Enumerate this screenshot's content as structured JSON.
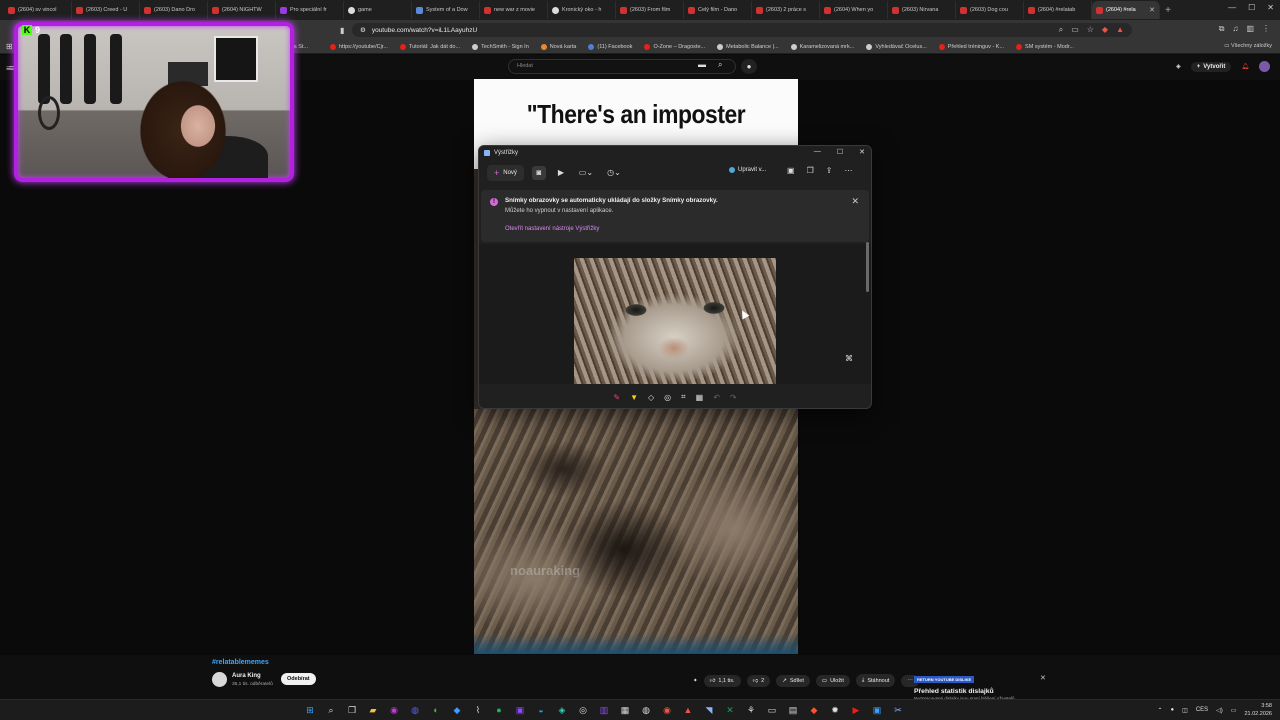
{
  "browser": {
    "tabs": [
      {
        "label": "(2604) sv vincol",
        "fav": "r"
      },
      {
        "label": "(2603) Creed - U",
        "fav": "r"
      },
      {
        "label": "(2603) Dano Dro",
        "fav": "r"
      },
      {
        "label": "(2604) NIGHTW",
        "fav": "r"
      },
      {
        "label": "Pro speciální fr",
        "fav": "p"
      },
      {
        "label": "game",
        "fav": "g"
      },
      {
        "label": "System of a Dow",
        "fav": "b"
      },
      {
        "label": "new war z movie",
        "fav": "r"
      },
      {
        "label": "Kronický oko - h",
        "fav": "g"
      },
      {
        "label": "(2603) From film",
        "fav": "r"
      },
      {
        "label": "Celý film - Dano",
        "fav": "r"
      },
      {
        "label": "(2603) 2 práce s",
        "fav": "r"
      },
      {
        "label": "(2604) When yo",
        "fav": "r"
      },
      {
        "label": "(2603) Nirvana",
        "fav": "r"
      },
      {
        "label": "(2603) Dog cou",
        "fav": "r"
      },
      {
        "label": "(2604) #relatab",
        "fav": "r"
      },
      {
        "label": "(2604) #rela",
        "fav": "r",
        "active": true
      }
    ],
    "url": "youtube.com/watch?v=iL1LAayuhzU",
    "bookmarks": [
      {
        "label": "https://youtube/Cjr...",
        "dot": "r"
      },
      {
        "label": "Tutoriál: Jak dát do...",
        "dot": "r"
      },
      {
        "label": "TechSmith - Sign In",
        "dot": "w"
      },
      {
        "label": "Nová karta",
        "dot": "o"
      },
      {
        "label": "(11) Facebook",
        "dot": "b"
      },
      {
        "label": "O-Zone – Dragoste...",
        "dot": "r"
      },
      {
        "label": "Metabolic Balance |...",
        "dot": "w"
      },
      {
        "label": "Karamelizovaná mrk...",
        "dot": "w"
      },
      {
        "label": "Vyhledávač Ocelus...",
        "dot": "w"
      },
      {
        "label": "Přehled tréninguv - K...",
        "dot": "r"
      },
      {
        "label": "SM systém - Modr...",
        "dot": "r"
      }
    ],
    "bookmarks_all": "Všechny záložky",
    "bookmarks_first": "ntasia St..."
  },
  "youtube": {
    "search_placeholder": "Hledat",
    "create_label": "Vytvořit",
    "video_caption_line1": "\"There's an imposter",
    "video_watermark": "noauraking",
    "hashtag": "#relatablememes",
    "channel_name": "Aura King",
    "channel_subs": "35,1 tis. odběratelů",
    "subscribe_label": "Odebírat",
    "likes": "1,1 tis.",
    "comments": "2",
    "share_label": "Sdílet",
    "save_label": "Uložit",
    "download_label": "Stáhnout",
    "dashboard_badge": "RETURN YOUTUBE DISLIKE",
    "dashboard_title": "Přehled statistik dislajků",
    "dashboard_sub": "Nezpracované dislajky jsou první hlášení uživatelů"
  },
  "stream": {
    "kick_count": "9"
  },
  "snipping_tool": {
    "title": "Výstřižky",
    "new_label": "Nový",
    "edit_label": "Upravit v...",
    "notice_title": "Snímky obrazovky se automaticky ukládají do složky Snímky obrazovky.",
    "notice_body": "Můžete ho vypnout v nastavení aplikace.",
    "notice_link": "Otevřít nastavení nástroje Výstřižky"
  },
  "taskbar": {
    "language": "CES",
    "time": "3:58",
    "date": "21.02.2026"
  },
  "colors": {
    "webcam_border": "#b220e0",
    "kick_green": "#53fc18",
    "link_blue": "#3ea6ff",
    "snip_accent": "#d56ad8"
  }
}
